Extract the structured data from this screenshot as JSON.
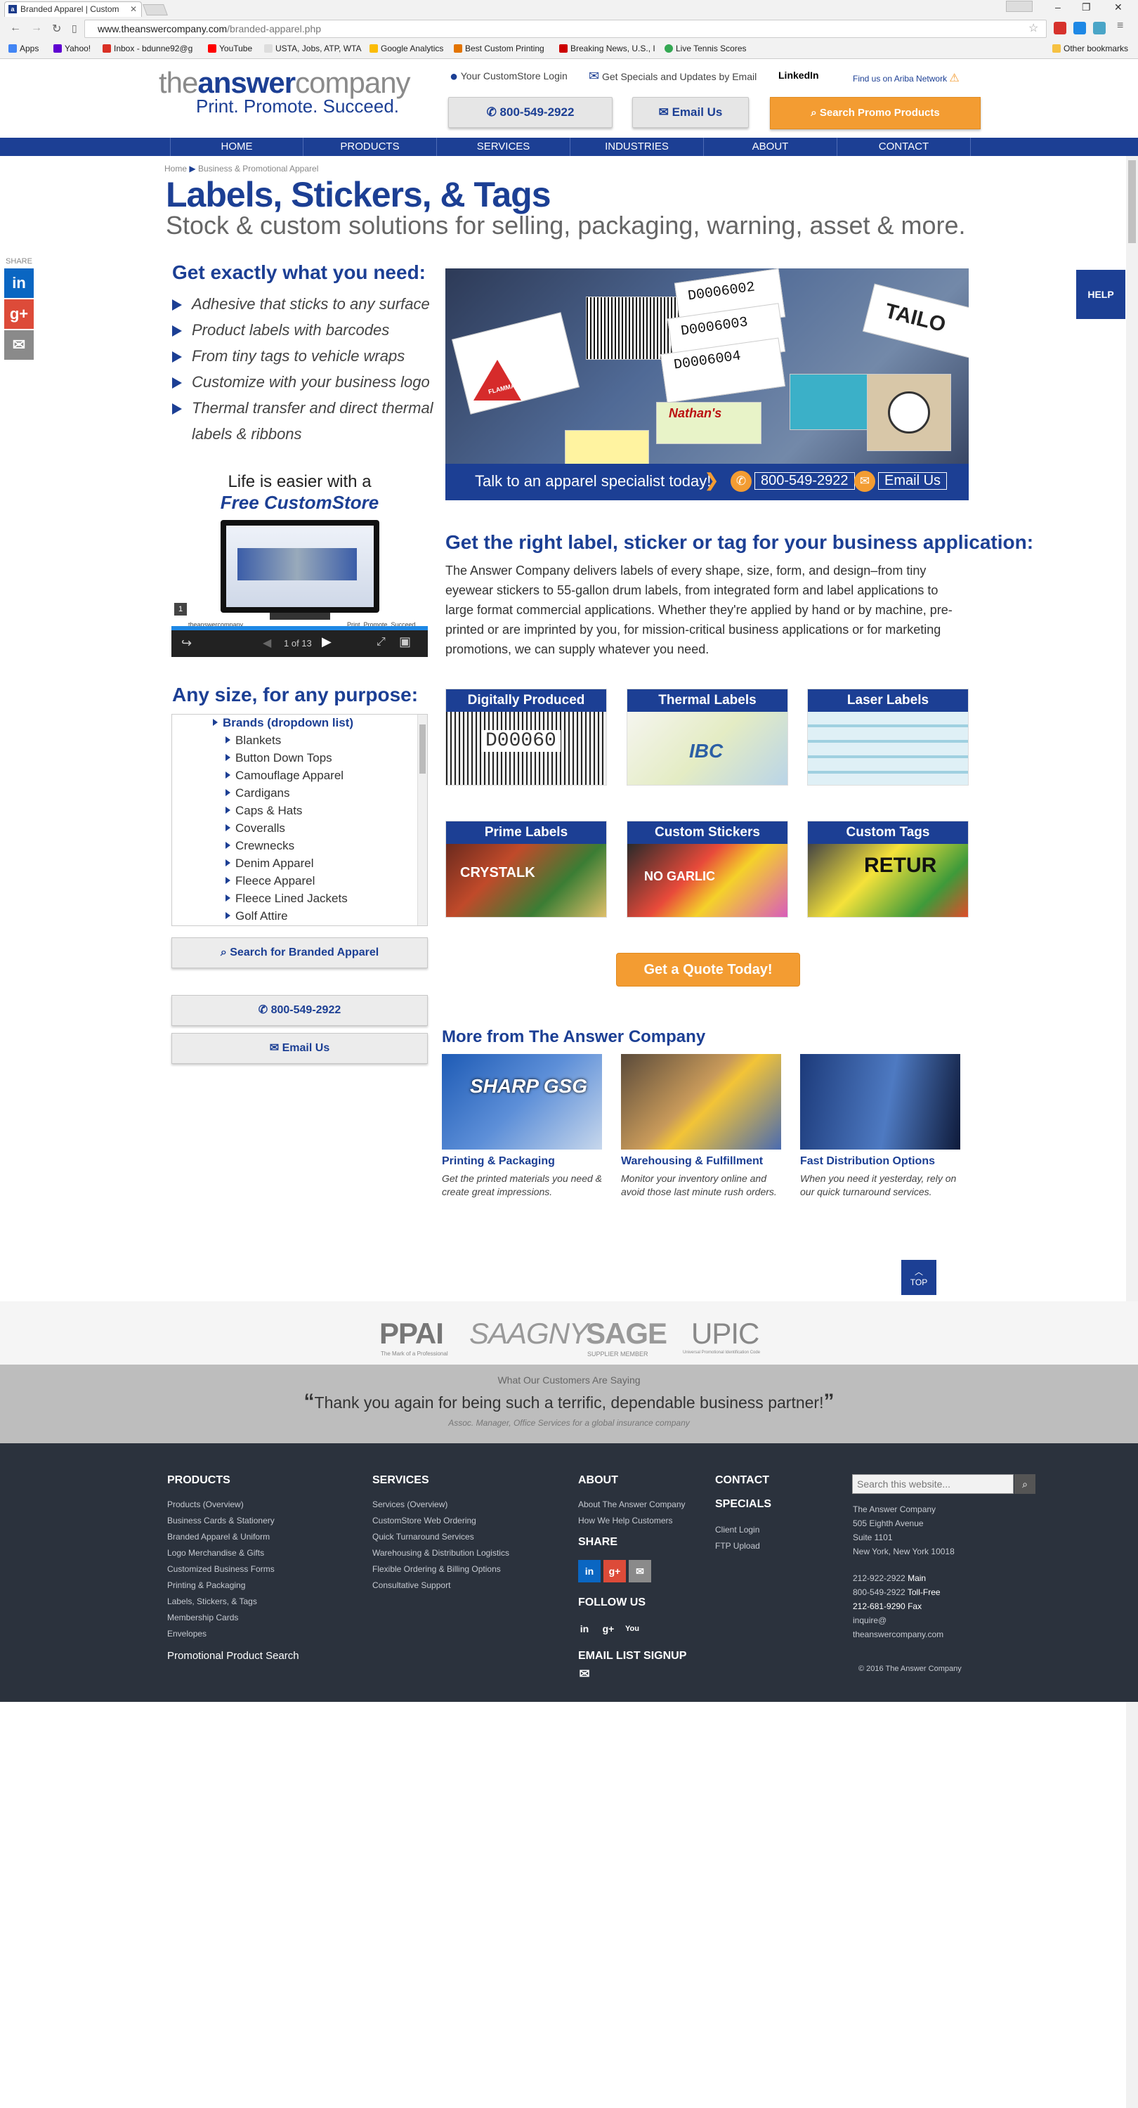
{
  "browser": {
    "tab_title": "Branded Apparel | Custom",
    "url_host": "www.theanswercompany.com",
    "url_path": "/branded-apparel.php",
    "bookmarks": [
      "Apps",
      "Yahoo!",
      "Inbox - bdunne92@g",
      "YouTube",
      "USTA, Jobs, ATP, WTA",
      "Google Analytics",
      "Best Custom Printing",
      "Breaking News, U.S., I",
      "Live Tennis Scores"
    ],
    "other_bookmarks": "Other bookmarks"
  },
  "header": {
    "logo_plain": "theanswer",
    "logo_bold": "answer",
    "logo_tail": "company",
    "tagline": "Print. Promote. Succeed.",
    "customstore_login": "Your CustomStore Login",
    "specials_signup": "Get Specials and Updates by Email",
    "linkedin": "LinkedIn",
    "ariba": "Find us on Ariba Network",
    "phone_button": "800-549-2922",
    "email_button": "Email Us",
    "search_promo_button": "Search Promo Products"
  },
  "nav": [
    "HOME",
    "PRODUCTS",
    "SERVICES",
    "INDUSTRIES",
    "ABOUT",
    "CONTACT"
  ],
  "breadcrumb": {
    "home": "Home",
    "current": "Business & Promotional Apparel"
  },
  "page": {
    "title": "Labels, Stickers, & Tags",
    "subtitle": "Stock & custom solutions for selling, packaging, warning, asset & more."
  },
  "share_rail": {
    "label": "SHARE"
  },
  "help_tab": "HELP",
  "need": {
    "heading": "Get exactly what you need:",
    "bullets": [
      "Adhesive that sticks to any surface",
      "Product labels with barcodes",
      "From tiny tags to vehicle wraps",
      "Customize with your business logo",
      "Thermal transfer and direct thermal",
      "labels & ribbons"
    ]
  },
  "hero": {
    "talk_text": "Talk to an apparel specialist today!",
    "phone": "800-549-2922",
    "email": "Email Us",
    "sticker_texts": [
      "D0006002",
      "D0006003",
      "D0006004",
      "Nathan's",
      "TAILO",
      "FLAMMABLE LIQUID"
    ]
  },
  "viewer": {
    "title_line1": "Life is easier with a",
    "title_line2": "Free CustomStore",
    "page_num": "1",
    "counter": "1 of 13",
    "brand_left": "theanswercompany",
    "brand_right": "Print. Promote. Succeed."
  },
  "right_section": {
    "heading": "Get the right label, sticker or tag for your business application:",
    "paragraph": "The Answer Company delivers labels of every shape, size, form, and design–from tiny eyewear stickers to 55-gallon drum labels, from integrated form and label applications to large format commercial applications. Whether they're applied by hand or by machine, pre-printed or are imprinted by you, for mission-critical business applications or for marketing promotions, we can supply whatever you need."
  },
  "any_size": {
    "heading": "Any size, for any purpose:",
    "items": [
      "Brands (dropdown list)",
      "Blankets",
      "Button Down Tops",
      "Camouflage Apparel",
      "Cardigans",
      "Caps & Hats",
      "Coveralls",
      "Crewnecks",
      "Denim Apparel",
      "Fleece Apparel",
      "Fleece Lined Jackets",
      "Golf Attire"
    ]
  },
  "left_buttons": {
    "search": "Search for Branded Apparel",
    "phone": "800-549-2922",
    "email": "Email Us"
  },
  "tiles": [
    {
      "title": "Digitally Produced",
      "img_text": "D00060"
    },
    {
      "title": "Thermal Labels",
      "img_text": "IBC"
    },
    {
      "title": "Laser Labels",
      "img_text": ""
    },
    {
      "title": "Prime Labels",
      "img_text": "CRYSTALK"
    },
    {
      "title": "Custom Stickers",
      "img_text": "NO GARLIC"
    },
    {
      "title": "Custom Tags",
      "img_text": "RETUR"
    }
  ],
  "quote_button": "Get a Quote Today!",
  "more_from": {
    "heading": "More from The Answer Company",
    "items": [
      {
        "title": "Printing & Packaging",
        "desc": "Get the printed materials you need & create great impressions.",
        "img_text": "SHARP GSG"
      },
      {
        "title": "Warehousing & Fulfillment",
        "desc": "Monitor your inventory online and avoid those last minute rush orders."
      },
      {
        "title": "Fast Distribution Options",
        "desc": "When you need it yesterday, rely on our quick turnaround services."
      }
    ]
  },
  "top_button": "TOP",
  "partners": [
    "PPAI",
    "SAAGNY",
    "SAGE",
    "UPIC"
  ],
  "partner_sub": [
    "The Mark of a Professional",
    "SUPPLIER MEMBER",
    "Universal Promotional Identification Code"
  ],
  "testimonial": {
    "label": "What Our Customers Are Saying",
    "quote": "Thank you again for being such a terrific, dependable business partner!",
    "attribution": "Assoc. Manager, Office Services for a global insurance company"
  },
  "footer": {
    "products_h": "PRODUCTS",
    "products": [
      "Products (Overview)",
      "Business Cards & Stationery",
      "Branded Apparel & Uniform",
      "Logo Merchandise & Gifts",
      "Customized Business Forms",
      "Printing & Packaging",
      "Labels, Stickers, & Tags",
      "Membership Cards",
      "Envelopes"
    ],
    "promo_search": "Promotional Product Search",
    "services_h": "SERVICES",
    "services": [
      "Services (Overview)",
      "CustomStore Web Ordering",
      "Quick Turnaround Services",
      "Warehousing & Distribution Logistics",
      "Flexible Ordering & Billing Options",
      "Consultative Support"
    ],
    "about_h": "ABOUT",
    "about": [
      "About The Answer Company",
      "How We Help Customers"
    ],
    "share_h": "SHARE",
    "follow_h": "FOLLOW US",
    "email_h": "EMAIL LIST SIGNUP",
    "contact_h": "CONTACT",
    "specials_h": "SPECIALS",
    "contact_links": [
      "Client Login",
      "FTP Upload"
    ],
    "search_placeholder": "Search this website...",
    "address": [
      "The Answer Company",
      "505 Eighth Avenue",
      "Suite 1101",
      "New York, New York 10018"
    ],
    "phone_main_num": "212-922-2922",
    "phone_main_lbl": "Main",
    "phone_toll_num": "800-549-2922",
    "phone_toll_lbl": "Toll-Free",
    "fax": "212-681-9290 Fax",
    "email1": "inquire@",
    "email2": "theanswercompany.com",
    "copyright": "© 2016 The Answer Company"
  },
  "colors": {
    "brand_blue": "#1c3f94",
    "orange": "#f39c32",
    "footer_bg": "#2b323d"
  }
}
